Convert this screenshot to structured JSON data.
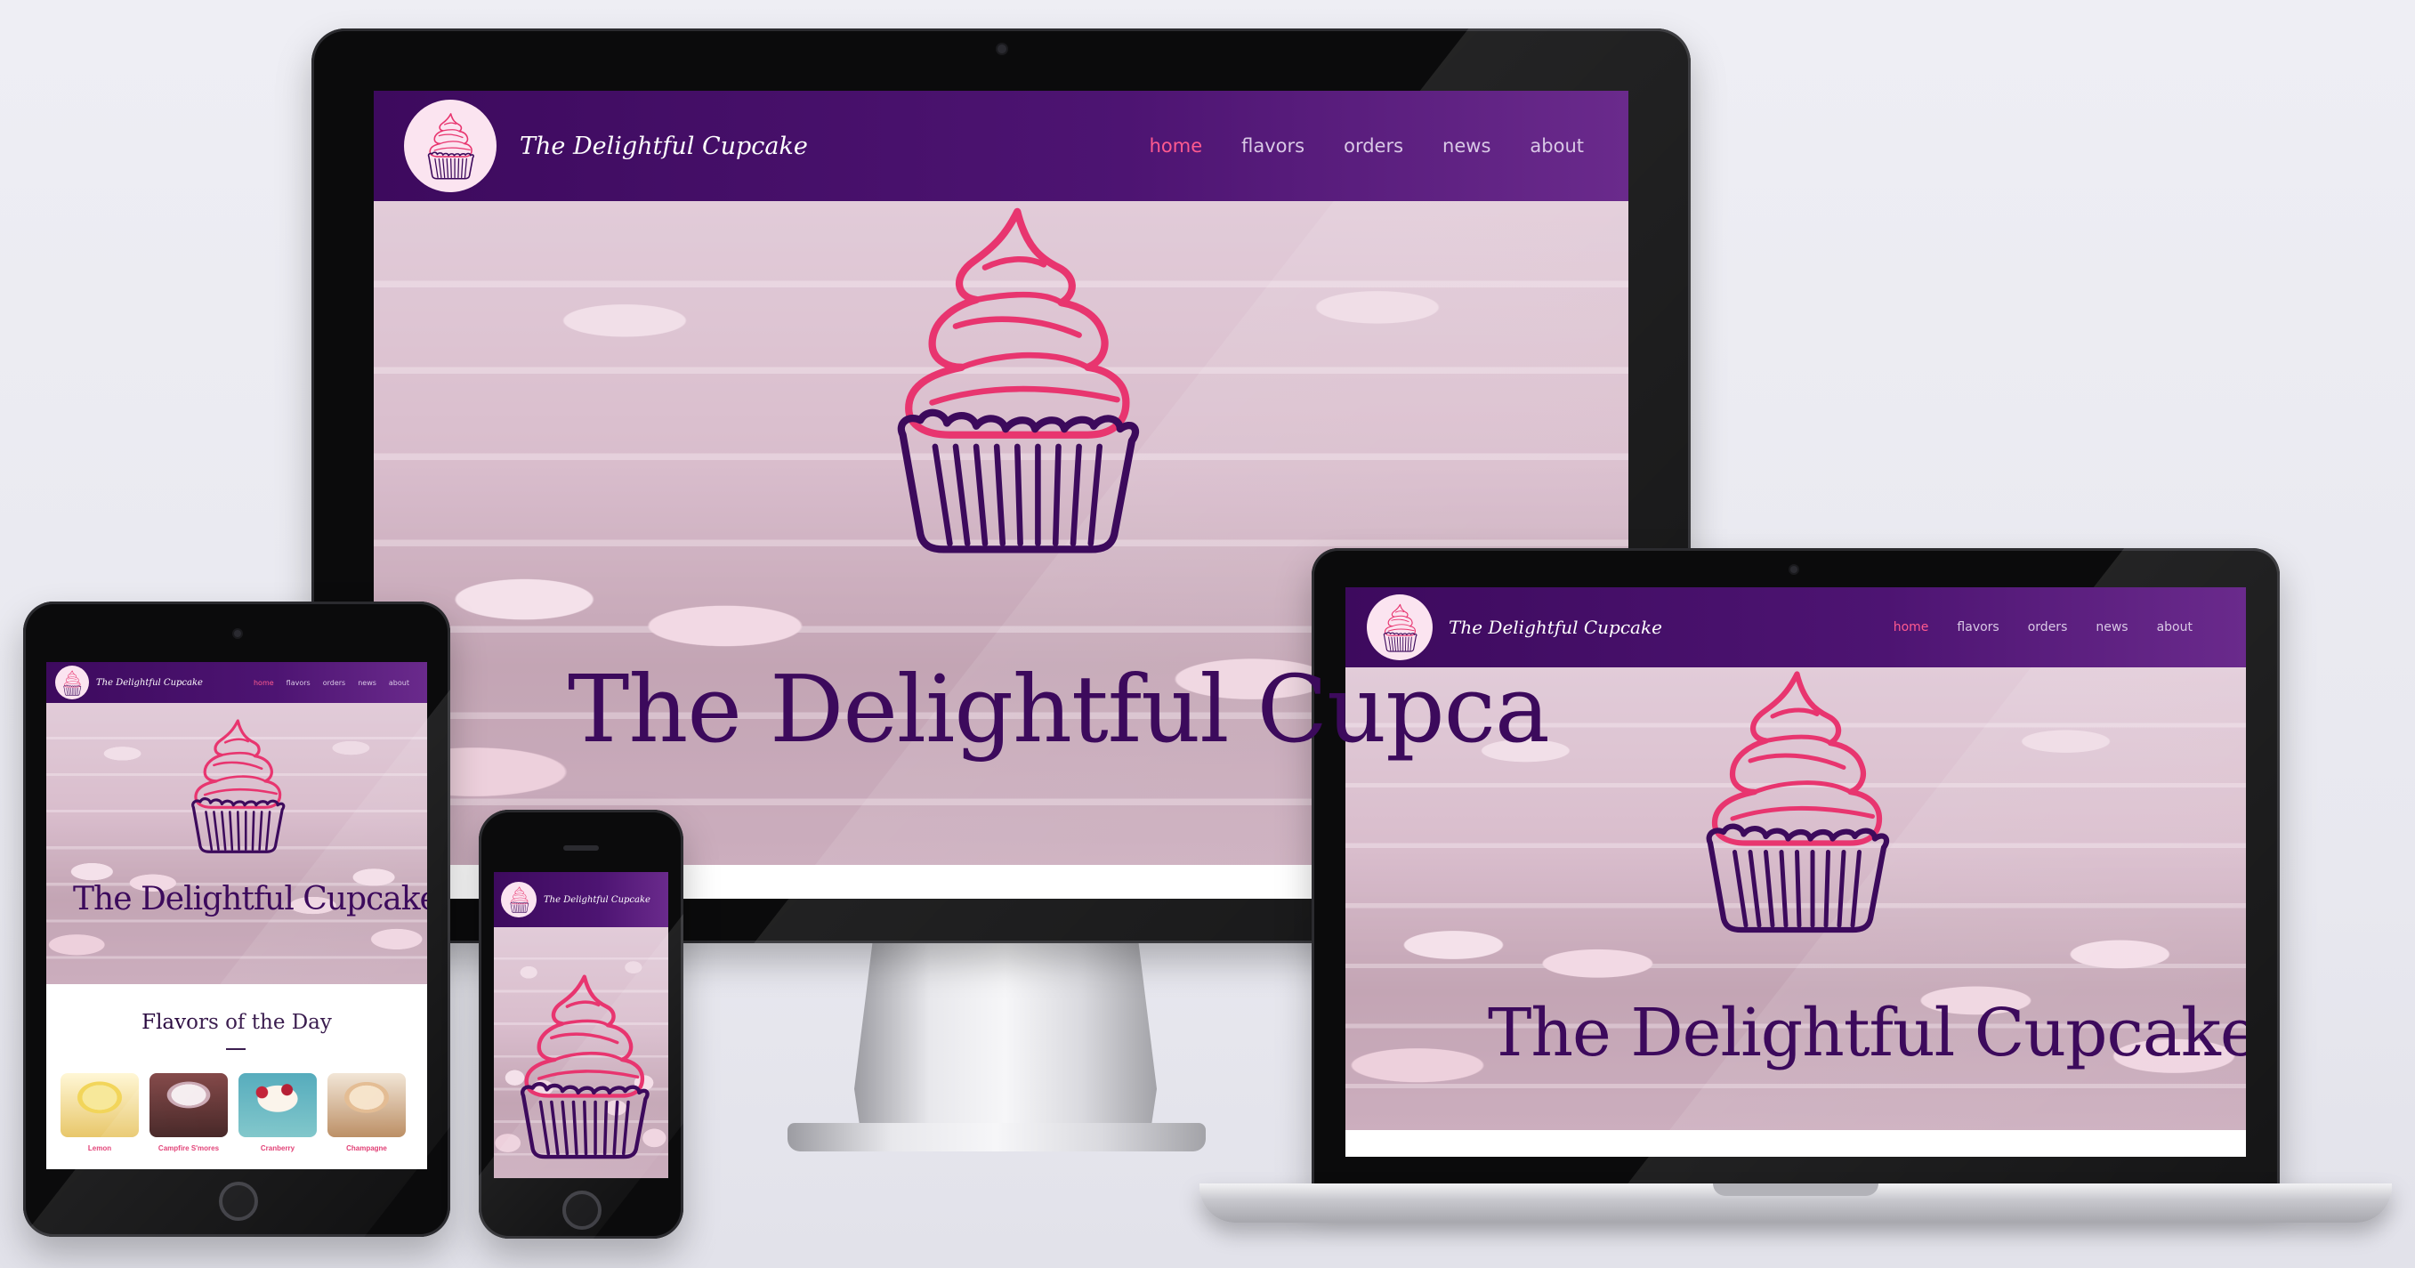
{
  "site": {
    "brand": "The Delightful Cupcake",
    "hero_title": "The Delightful Cupcake",
    "nav": [
      "home",
      "flavors",
      "orders",
      "news",
      "about"
    ],
    "active_nav": "home"
  },
  "desktop": {
    "hero_title_visible": "The Delightful Cupca"
  },
  "tablet": {
    "section_title": "Flavors of the Day",
    "flavors": [
      "Lemon",
      "Campfire S'mores",
      "Cranberry",
      "Champagne"
    ]
  },
  "colors": {
    "nav": "#3d0a5e",
    "accent": "#ff5a8f",
    "title": "#3c0a5c",
    "frosting": "#e8356f",
    "wrapper": "#3c0a5c"
  },
  "icons": [
    "cupcake-logo-icon",
    "cupcake-hero-icon"
  ]
}
